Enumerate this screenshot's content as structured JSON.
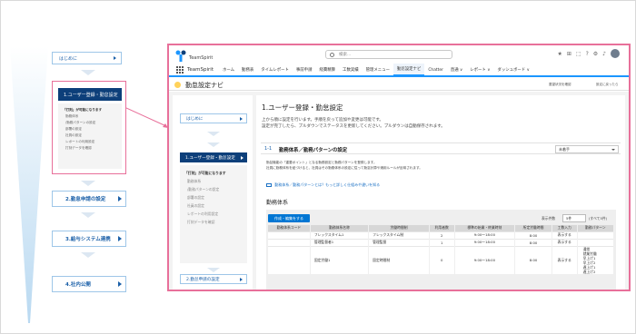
{
  "left_flow": {
    "intro_label": "はじめに",
    "step1_label": "1.ユーザー登録・勤怠設定",
    "step1_sub": [
      "「打刻」が可能になります",
      "勤務体系",
      "/勤務パターンの設定",
      "部署の設定",
      "社員の設定",
      "レポートの利用設定",
      "打刻データを確認"
    ],
    "step2_label": "2.勤怠申請の設定",
    "step3_label": "3.給与システム連携",
    "step4_label": "4.社内公開"
  },
  "header": {
    "app_name": "TeamSpirit",
    "search_placeholder": "検索...",
    "nav_app_title": "TeamSpirit",
    "nav_items": [
      "ホーム",
      "勤務表",
      "タイムレポート",
      "事前申請",
      "経費精算",
      "工数実績",
      "管理メニュー",
      "勤怠設定ナビ",
      "Chatter",
      "直通 ∨",
      "レポート ∨",
      "ダッシュボード ∨"
    ]
  },
  "page": {
    "title": "勤怠設定ナビ",
    "header_right_1": "要望状況を確認",
    "header_right_2": "設定に戻ったら"
  },
  "sidebar": {
    "intro_label": "はじめに",
    "active_label": "1.ユーザー登録・勤怠設定",
    "sub_head": "「打刻」が可能になります",
    "sub_items": [
      "勤務体系",
      "/勤務パターンの設定",
      "部署の設定",
      "社員の設定",
      "レポートの利用設定",
      "打刻データを確認"
    ],
    "next_label": "2.勤怠申請の設定"
  },
  "content": {
    "heading": "1.ユーザー登録・勤怠設定",
    "desc1": "上から順に設定を行います。手順を戻って追加や変更は可能です。",
    "desc2": "設定が完了したら、プルダウンでステータスを更新してください。プルダウンは自動保存されます。",
    "section_num": "1-1",
    "section_title": "勤務体系／勤務パターンの設定",
    "status_select": "未着手",
    "note1": "勤怠機能の「重要ポイント」となる勤務設定と勤務パターンを登録します。",
    "note2": "社員に勤務体系を紐づけると、社員はその勤務体系の設定に従って勤怠計算や適用ルールが反映されます。",
    "link_text": "勤務体系／勤務パターンとは？もっと詳しく仕組みや違いを知る",
    "table_title": "勤務体系",
    "create_button": "作成・編集をする",
    "page_label": "表示件数",
    "page_size": "5件",
    "page_count": "(すべて5件)",
    "columns": [
      "勤務体系コード",
      "勤務体系名称",
      "労働時間制",
      "利用者数",
      "標準の始業・終業時刻",
      "所定労働時間",
      "工数入力",
      "勤務パターン"
    ],
    "rows": [
      {
        "code": "",
        "name": "フレックスタイム1",
        "system": "フレックスタイム制",
        "users": "2",
        "time": "9:00～18:00",
        "hours": "8:00",
        "input": "表示する",
        "pattern": ""
      },
      {
        "code": "",
        "name": "管理監督者1",
        "system": "管理監督",
        "users": "1",
        "time": "9:00～18:00",
        "hours": "8:00",
        "input": "表示する",
        "pattern": ""
      },
      {
        "code": "",
        "name": "固定労働1",
        "system": "固定時間制",
        "users": "0",
        "time": "9:00～18:00",
        "hours": "8:00",
        "input": "表示する",
        "pattern": "通常\n就業労働\n早上げ1\n早上げ2\n遅上げ1\n遅上げ2"
      }
    ]
  }
}
